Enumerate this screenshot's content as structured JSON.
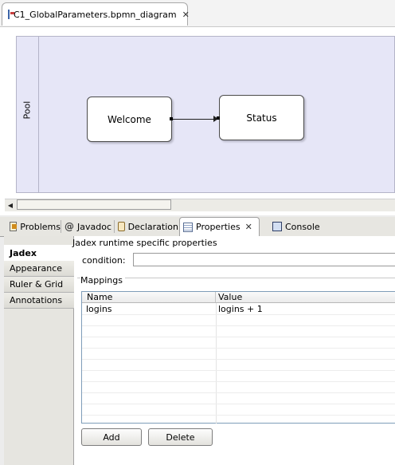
{
  "editor": {
    "tab_title": "C1_GlobalParameters.bpmn_diagram",
    "close_glyph": "✕"
  },
  "diagram": {
    "pool_label": "Pool",
    "tasks": [
      {
        "label": "Welcome"
      },
      {
        "label": "Status"
      }
    ],
    "scroll_left_glyph": "◀"
  },
  "views": {
    "tabs": [
      {
        "label": "Problems",
        "icon": "problems-icon"
      },
      {
        "label": "Javadoc",
        "icon": "javadoc-icon"
      },
      {
        "label": "Declaration",
        "icon": "declaration-icon"
      },
      {
        "label": "Properties",
        "icon": "properties-icon",
        "active": true
      },
      {
        "label": "Console",
        "icon": "console-icon"
      }
    ],
    "close_glyph": "✕",
    "at_glyph": "@"
  },
  "properties": {
    "side_tabs": [
      {
        "label": "Jadex",
        "active": true
      },
      {
        "label": "Appearance"
      },
      {
        "label": "Ruler & Grid"
      },
      {
        "label": "Annotations"
      }
    ],
    "heading": "Jadex runtime specific properties",
    "condition_label": "condition:",
    "condition_value": "",
    "mappings_label": "Mappings",
    "table": {
      "columns": [
        "Name",
        "Value"
      ],
      "rows": [
        {
          "name": "logins",
          "value": "logins + 1"
        }
      ]
    },
    "buttons": {
      "add": "Add",
      "delete": "Delete"
    }
  }
}
